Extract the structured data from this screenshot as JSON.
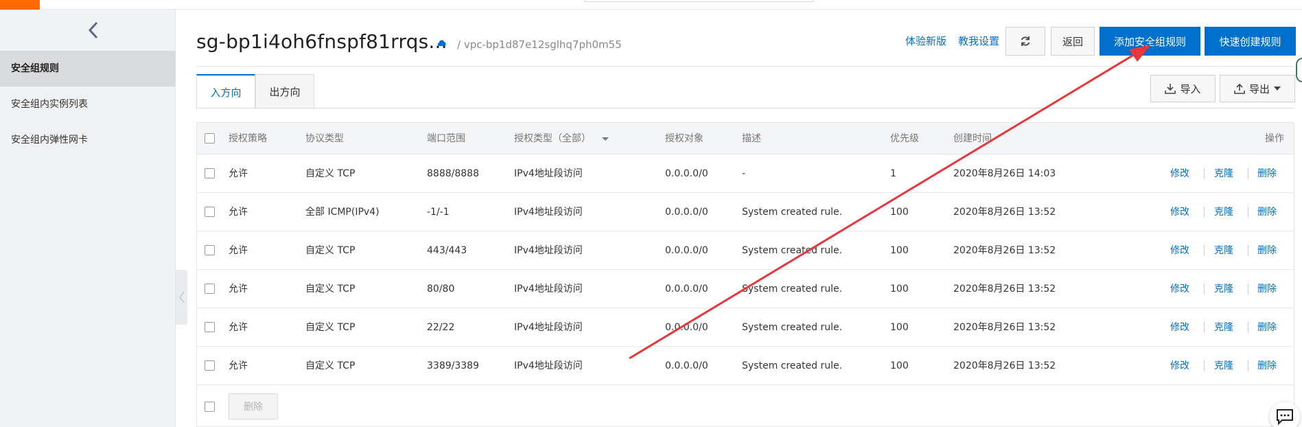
{
  "sidebar": {
    "items": [
      {
        "label": "安全组规则",
        "active": true
      },
      {
        "label": "安全组内实例列表",
        "active": false
      },
      {
        "label": "安全组内弹性网卡",
        "active": false
      }
    ]
  },
  "header": {
    "title": "sg-bp1i4oh6fnspf81rrqs...",
    "vpc_path": "/ vpc-bp1d87e12sglhq7ph0m55",
    "link_new_version": "体验新版",
    "link_tutorial": "教我设置",
    "btn_back": "返回",
    "btn_add_rule": "添加安全组规则",
    "btn_quick_create": "快速创建规则"
  },
  "tabs": [
    {
      "label": "入方向",
      "active": true
    },
    {
      "label": "出方向",
      "active": false
    }
  ],
  "toolbar": {
    "import_label": "导入",
    "export_label": "导出"
  },
  "table": {
    "headers": {
      "policy": "授权策略",
      "protocol": "协议类型",
      "port": "端口范围",
      "auth_type": "授权类型（全部）",
      "target": "授权对象",
      "desc": "描述",
      "priority": "优先级",
      "created": "创建时间",
      "ops": "操作"
    },
    "rows": [
      {
        "policy": "允许",
        "protocol": "自定义 TCP",
        "port": "8888/8888",
        "auth_type": "IPv4地址段访问",
        "target": "0.0.0.0/0",
        "desc": "-",
        "priority": "1",
        "created": "2020年8月26日 14:03"
      },
      {
        "policy": "允许",
        "protocol": "全部 ICMP(IPv4)",
        "port": "-1/-1",
        "auth_type": "IPv4地址段访问",
        "target": "0.0.0.0/0",
        "desc": "System created rule.",
        "priority": "100",
        "created": "2020年8月26日 13:52"
      },
      {
        "policy": "允许",
        "protocol": "自定义 TCP",
        "port": "443/443",
        "auth_type": "IPv4地址段访问",
        "target": "0.0.0.0/0",
        "desc": "System created rule.",
        "priority": "100",
        "created": "2020年8月26日 13:52"
      },
      {
        "policy": "允许",
        "protocol": "自定义 TCP",
        "port": "80/80",
        "auth_type": "IPv4地址段访问",
        "target": "0.0.0.0/0",
        "desc": "System created rule.",
        "priority": "100",
        "created": "2020年8月26日 13:52"
      },
      {
        "policy": "允许",
        "protocol": "自定义 TCP",
        "port": "22/22",
        "auth_type": "IPv4地址段访问",
        "target": "0.0.0.0/0",
        "desc": "System created rule.",
        "priority": "100",
        "created": "2020年8月26日 13:52"
      },
      {
        "policy": "允许",
        "protocol": "自定义 TCP",
        "port": "3389/3389",
        "auth_type": "IPv4地址段访问",
        "target": "0.0.0.0/0",
        "desc": "System created rule.",
        "priority": "100",
        "created": "2020年8月26日 13:52"
      }
    ],
    "row_ops": {
      "edit": "修改",
      "clone": "克隆",
      "delete": "删除"
    },
    "footer_delete": "删除"
  },
  "colors": {
    "accent": "#0070cc",
    "brand": "#ff6a00",
    "annotation_arrow": "#e8373a"
  }
}
